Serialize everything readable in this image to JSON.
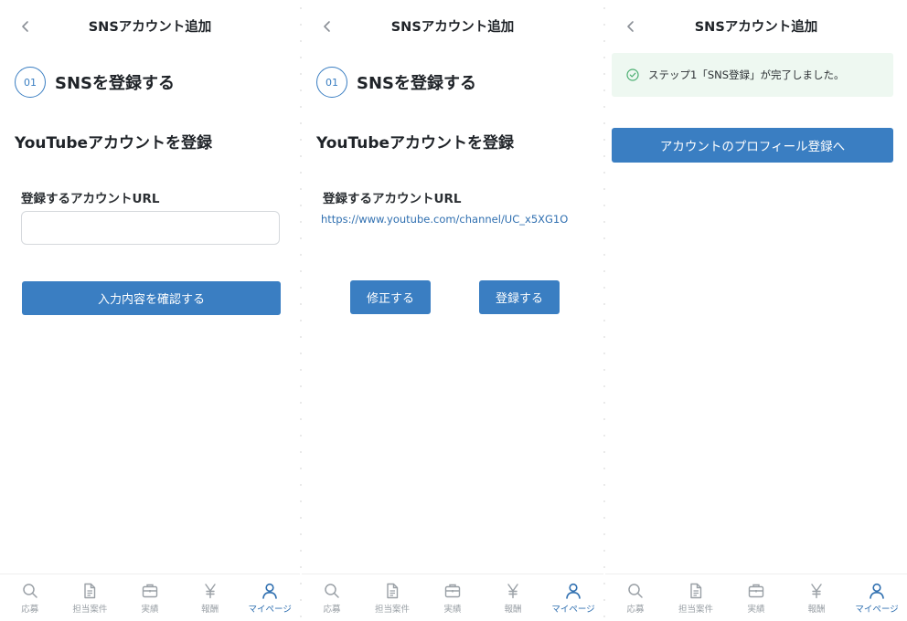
{
  "colors": {
    "accent": "#3a7ec2",
    "link": "#2f6fb0",
    "notice_bg": "#eef8f1",
    "success": "#4caf72",
    "inactive": "#9aa0a6"
  },
  "screen1": {
    "header_title": "SNSアカウント追加",
    "step_number": "01",
    "step_title": "SNSを登録する",
    "section_title": "YouTubeアカウントを登録",
    "field_label": "登録するアカウントURL",
    "input_value": "",
    "confirm_button": "入力内容を確認する"
  },
  "screen2": {
    "header_title": "SNSアカウント追加",
    "step_number": "01",
    "step_title": "SNSを登録する",
    "section_title": "YouTubeアカウントを登録",
    "field_label": "登録するアカウントURL",
    "url_value": "https://www.youtube.com/channel/UC_x5XG1O",
    "edit_button": "修正する",
    "register_button": "登録する"
  },
  "screen3": {
    "header_title": "SNSアカウント追加",
    "notice_icon": "check-circle-icon",
    "notice_text": "ステップ1「SNS登録」が完了しました。",
    "profile_button": "アカウントのプロフィール登録へ"
  },
  "tabbar": {
    "active_tab": "マイページ",
    "items": [
      {
        "label": "応募",
        "icon": "search-icon"
      },
      {
        "label": "担当案件",
        "icon": "document-icon"
      },
      {
        "label": "実績",
        "icon": "briefcase-icon"
      },
      {
        "label": "報酬",
        "icon": "yen-icon"
      },
      {
        "label": "マイページ",
        "icon": "person-icon"
      }
    ]
  }
}
